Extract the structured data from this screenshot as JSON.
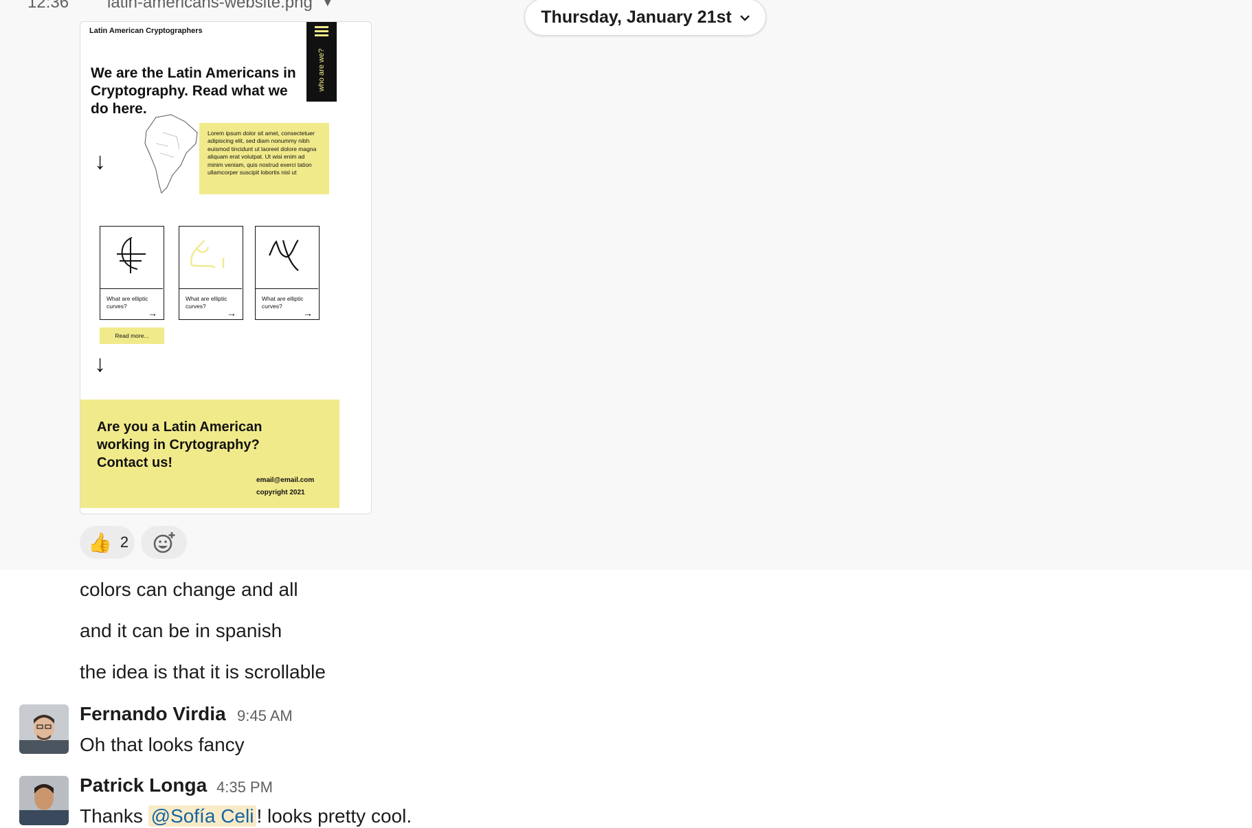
{
  "file": {
    "timestamp": "12:36",
    "name": "latin-americans-website.png"
  },
  "date_divider": "Thursday, January 21st",
  "preview": {
    "brand": "Latin American Cryptographers",
    "side_label": "who are we?",
    "hero": "We are the Latin Americans in Cryptography. Read what we do here.",
    "lorem": "Lorem ipsum dolor sit amet, consectetuer adipiscing elit, sed diam nonummy nibh euismod tincidunt ut laoreet dolore magna aliquam erat volutpat. Ut wisi enim ad minim veniam, quis nostrud exerci tation ullamcorper suscipit lobortis nisl ut",
    "cards": [
      {
        "caption": "What are elliptic curves?"
      },
      {
        "caption": "What are elliptic curves?"
      },
      {
        "caption": "What are elliptic curves?"
      }
    ],
    "read_more": "Read more...",
    "contact_heading": "Are you a Latin American working in Crytography? Contact us!",
    "email": "email@email.com",
    "copyright": "copyright 2021",
    "accent": "#f1ea8b"
  },
  "reactions": {
    "thumbs_emoji": "👍",
    "thumbs_count": "2",
    "add_icon": "add-reaction-icon"
  },
  "messages": [
    {
      "text": "colors can change and all"
    },
    {
      "text": "and it can be in spanish"
    },
    {
      "text": "the idea is that it is scrollable"
    }
  ],
  "posts": [
    {
      "sender": "Fernando Virdia",
      "time": "9:45 AM",
      "text": "Oh that looks fancy"
    },
    {
      "sender": "Patrick Longa",
      "time": "4:35 PM",
      "text_before": "Thanks ",
      "mention": "@Sofía Celi",
      "text_after": "! looks pretty cool."
    }
  ]
}
